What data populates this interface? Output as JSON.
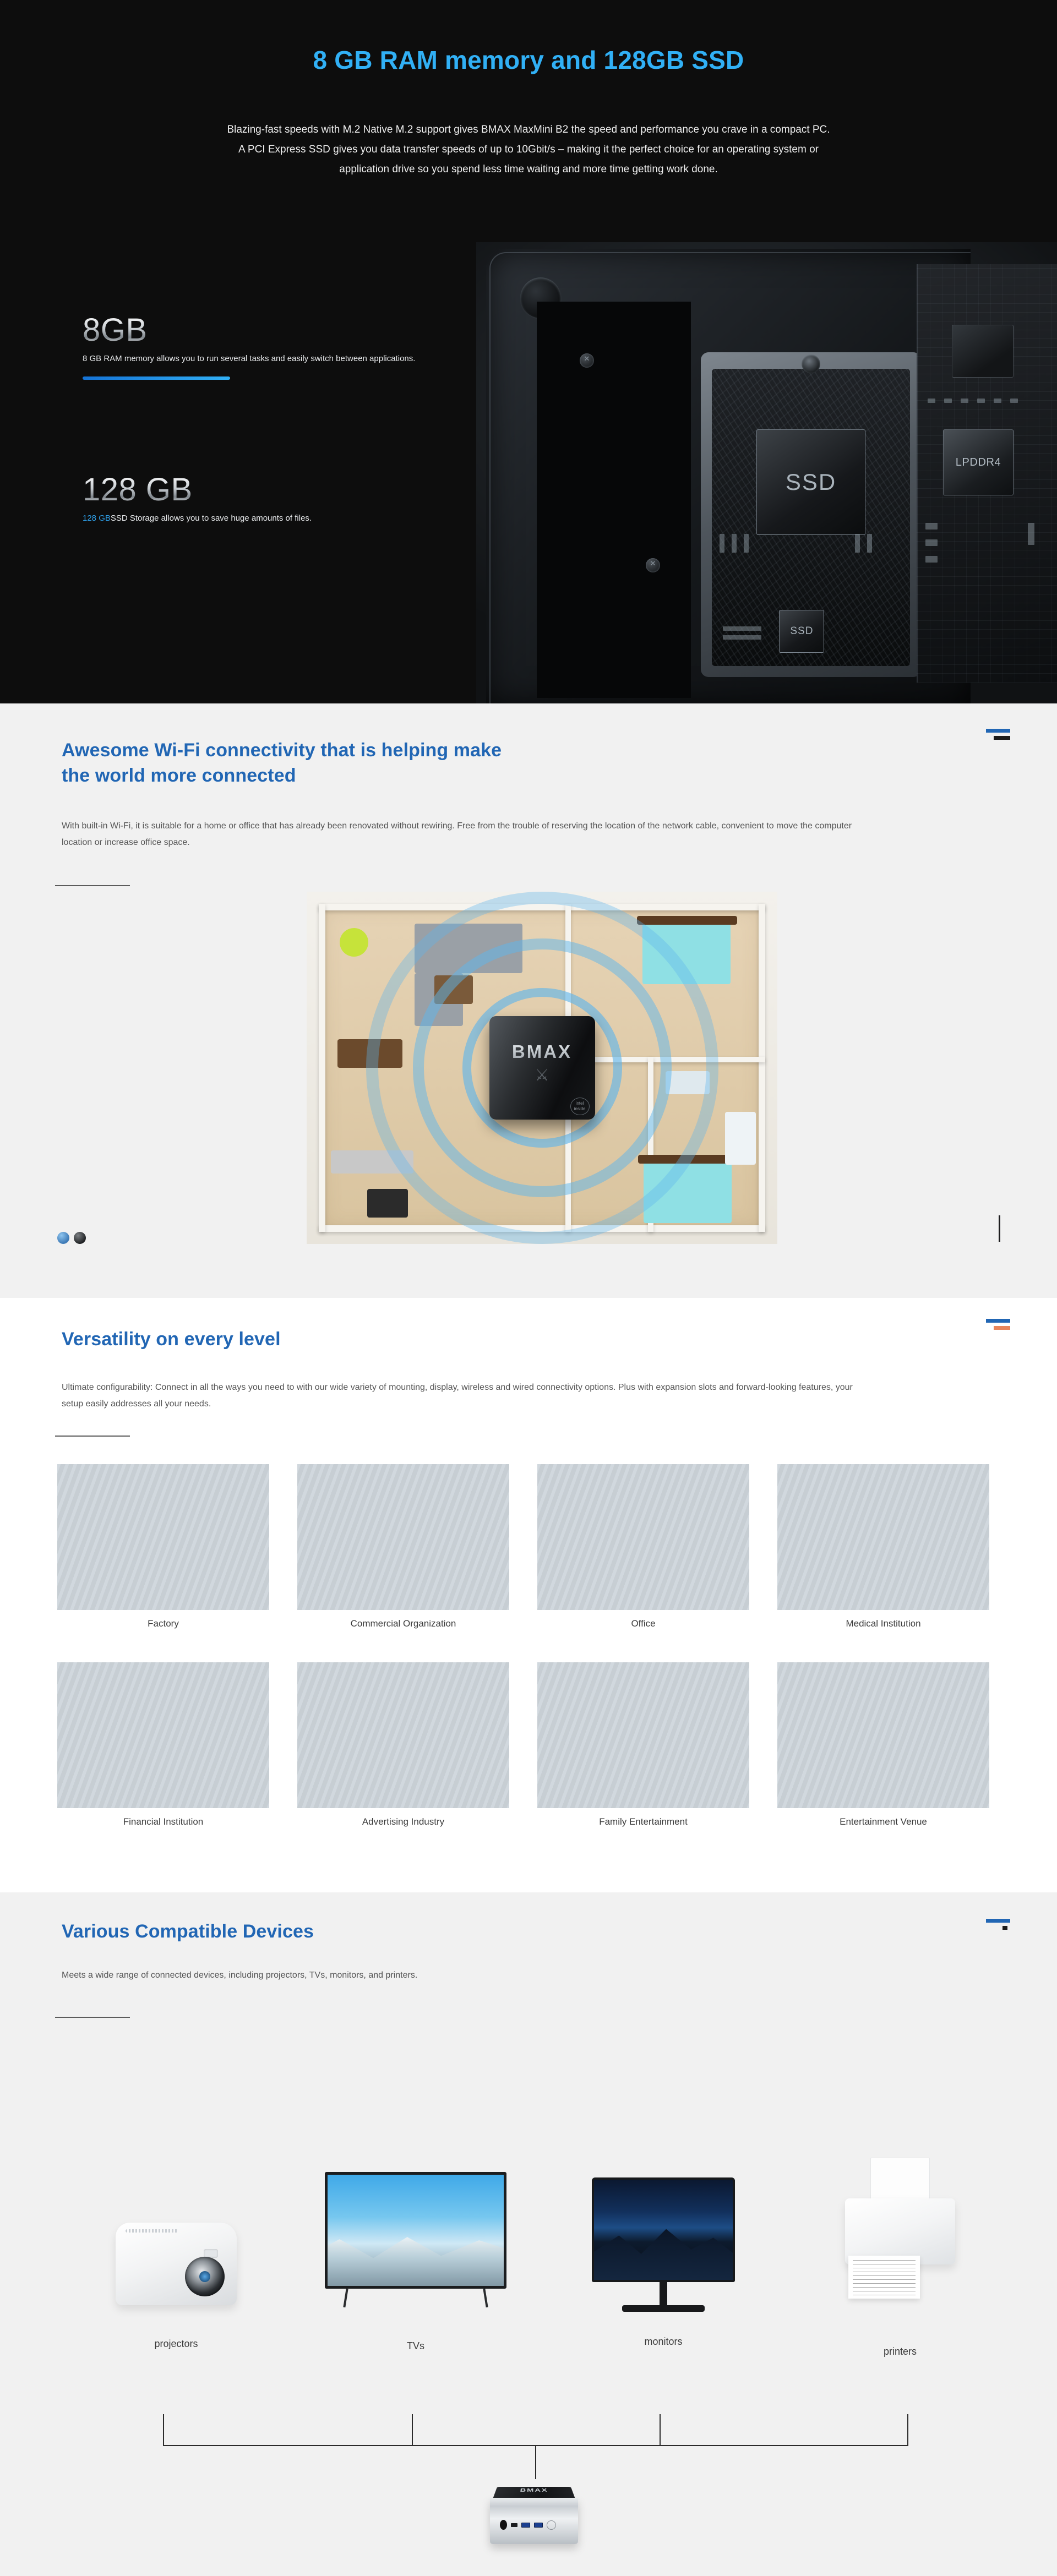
{
  "hero": {
    "title": "8 GB RAM memory and 128GB SSD",
    "description": "Blazing-fast speeds with M.2 Native M.2 support gives BMAX MaxMini B2 the speed and performance you crave in a compact PC. A PCI Express SSD gives you data transfer speeds of up to 10Gbit/s – making it the perfect choice for an operating system or application drive so you spend less time waiting and more time getting work done.",
    "title_color": "#31b0f5",
    "background_color": "#0d0d0d",
    "stats": [
      {
        "value": "8GB",
        "description": "8 GB RAM memory allows you to run several tasks and easily switch between applications.",
        "highlight": "",
        "highlight_color": "#2e9fe8",
        "has_bar": true
      },
      {
        "value": "128 GB",
        "description": "SSD Storage allows you to save huge amounts of files.",
        "highlight": "128 GB",
        "highlight_color": "#2e9fe8",
        "has_bar": false
      }
    ],
    "chip_labels": {
      "ssd_large": "SSD",
      "ssd_small": "SSD",
      "memory": "LPDDR4"
    }
  },
  "wifi": {
    "title_line1": "Awesome Wi-Fi connectivity that is helping make",
    "title_line2": "the world more connected",
    "description": "With built-in Wi-Fi, it is suitable for a home or office that has already been renovated without rewiring. Free from the trouble of reserving the location of the network cable, convenient to move the computer location or increase office space.",
    "device_wordmark": "BMAX",
    "device_badge_line1": "intel",
    "device_badge_line2": "inside",
    "title_color": "#2166b4",
    "background_color": "#f1f1f1"
  },
  "versatility": {
    "title": "Versatility on every level",
    "description": "Ultimate configurability: Connect in all the ways you need to with our wide variety of mounting, display, wireless and wired connectivity options. Plus with expansion slots and forward-looking features, your setup easily addresses all your needs.",
    "title_color": "#2166b4",
    "background_color": "#ffffff",
    "cards": [
      {
        "label": "Factory"
      },
      {
        "label": "Commercial Organization"
      },
      {
        "label": "Office"
      },
      {
        "label": "Medical Institution"
      },
      {
        "label": "Financial Institution"
      },
      {
        "label": "Advertising Industry"
      },
      {
        "label": "Family Entertainment"
      },
      {
        "label": "Entertainment Venue"
      }
    ]
  },
  "devices": {
    "title": "Various Compatible Devices",
    "description": "Meets a wide range of connected devices, including projectors, TVs, monitors, and printers.",
    "title_color": "#2166b4",
    "background_color": "#f1f1f1",
    "items": [
      {
        "label": "projectors"
      },
      {
        "label": "TVs"
      },
      {
        "label": "monitors"
      },
      {
        "label": "printers"
      }
    ],
    "hub_wordmark": "BMAX"
  }
}
